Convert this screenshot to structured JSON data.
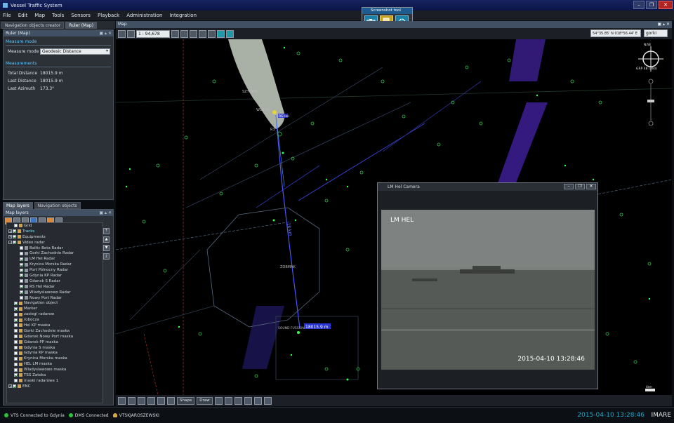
{
  "window": {
    "title": "Vessel Traffic System"
  },
  "menu": [
    "File",
    "Edit",
    "Map",
    "Tools",
    "Sensors",
    "Playback",
    "Administration",
    "Integration"
  ],
  "screenshot_tool": {
    "title": "Screenshot tool"
  },
  "left_tabs": [
    "Navigation objects creator",
    "Ruler (Map)"
  ],
  "ruler": {
    "panel_title": "Ruler (Map)",
    "measure_mode_header": "Measure mode",
    "measure_mode_label": "Measure mode",
    "measure_mode_value": "Geodesic Distance",
    "measurements_header": "Measurements",
    "total_distance_label": "Total Distance",
    "total_distance_value": "18015.9 m",
    "last_distance_label": "Last Distance",
    "last_distance_value": "18015.9 m",
    "last_azimuth_label": "Last Azimuth",
    "last_azimuth_value": "173.3°"
  },
  "layers_tabs": [
    "Map layers",
    "Navigation objects"
  ],
  "layers_panel": {
    "title": "Map layers",
    "items": [
      {
        "label": "Grid",
        "checked": false,
        "exp": "",
        "indent": 1
      },
      {
        "label": "Tracks",
        "checked": true,
        "exp": "+",
        "indent": 0,
        "selected": true
      },
      {
        "label": "Equipments",
        "checked": true,
        "exp": "+",
        "indent": 0
      },
      {
        "label": "Video radar",
        "checked": true,
        "exp": "-",
        "indent": 0
      },
      {
        "label": "Baltic Beta Radar",
        "checked": false,
        "exp": "",
        "indent": 2
      },
      {
        "label": "Gorki Zachodnie Radar",
        "checked": false,
        "exp": "",
        "indent": 2
      },
      {
        "label": "LM Hel Radar",
        "checked": true,
        "exp": "",
        "indent": 2
      },
      {
        "label": "Krynica Morska Radar",
        "checked": true,
        "exp": "",
        "indent": 2
      },
      {
        "label": "Port Pólnocny Radar",
        "checked": true,
        "exp": "",
        "indent": 2
      },
      {
        "label": "Gdynia KP Radar",
        "checked": true,
        "exp": "",
        "indent": 2
      },
      {
        "label": "Gdansk S Radar",
        "checked": false,
        "exp": "",
        "indent": 2
      },
      {
        "label": "RS Hel Radar",
        "checked": true,
        "exp": "",
        "indent": 2
      },
      {
        "label": "Wladyslawowo Radar",
        "checked": true,
        "exp": "",
        "indent": 2
      },
      {
        "label": "Nowy Port Radar",
        "checked": false,
        "exp": "",
        "indent": 2
      },
      {
        "label": "Navigation object",
        "checked": true,
        "exp": "",
        "indent": 1
      },
      {
        "label": "Marker",
        "checked": true,
        "exp": "",
        "indent": 1
      },
      {
        "label": "zasiegi radarow",
        "checked": false,
        "exp": "",
        "indent": 1
      },
      {
        "label": "robocza",
        "checked": true,
        "exp": "",
        "indent": 1
      },
      {
        "label": "Hel KP maska",
        "checked": false,
        "exp": "",
        "indent": 1
      },
      {
        "label": "Gorki Zachodnie maska",
        "checked": false,
        "exp": "",
        "indent": 1
      },
      {
        "label": "Gdansk Nowy Port maska",
        "checked": false,
        "exp": "",
        "indent": 1
      },
      {
        "label": "Gdansk PP maska",
        "checked": false,
        "exp": "",
        "indent": 1
      },
      {
        "label": "Gdynia S maska",
        "checked": false,
        "exp": "",
        "indent": 1
      },
      {
        "label": "Gdynia KP maska",
        "checked": false,
        "exp": "",
        "indent": 1
      },
      {
        "label": "Krynica Morska maska",
        "checked": false,
        "exp": "",
        "indent": 1
      },
      {
        "label": "HEL LM maska",
        "checked": false,
        "exp": "",
        "indent": 1
      },
      {
        "label": "Wladyslawowo maska",
        "checked": false,
        "exp": "",
        "indent": 1
      },
      {
        "label": "TSS Zatoka",
        "checked": true,
        "exp": "",
        "indent": 1
      },
      {
        "label": "maski radarowe 1",
        "checked": false,
        "exp": "",
        "indent": 1
      },
      {
        "label": "ENC",
        "checked": true,
        "exp": "+",
        "indent": 0
      }
    ]
  },
  "map": {
    "panel_title": "Map",
    "scale": "1 : 94,678",
    "coordinates": "54°35.85' N 018°56.44' E",
    "profile": "gorki",
    "labels": {
      "sztorm": "SZTORM",
      "wla_pd": "WLA PD",
      "track_tag": "RS Hel",
      "r3": "R3",
      "zoomak": "ZOBMAK",
      "sound_fuss": "SOUND FUSSION",
      "distance_tag": "18015.9 m",
      "ruler_label": "18 km",
      "compass_label": "GRP 48 (360)",
      "north_label": "N/SE",
      "scale_bar": "4km"
    },
    "bottom": {
      "shape": "Shape",
      "draw": "Draw"
    }
  },
  "camera": {
    "title": "LM Hel Camera",
    "overlay_name": "LM HEL",
    "overlay_time": "2015-04-10 13:28:46"
  },
  "status": {
    "vts": "VTS Connected to Gdynia",
    "dms": "DMS Connected",
    "user": "VTSKJAROSZEWSKI",
    "clock": "2015-04-10 13:28:46",
    "brand": "IMARE"
  }
}
